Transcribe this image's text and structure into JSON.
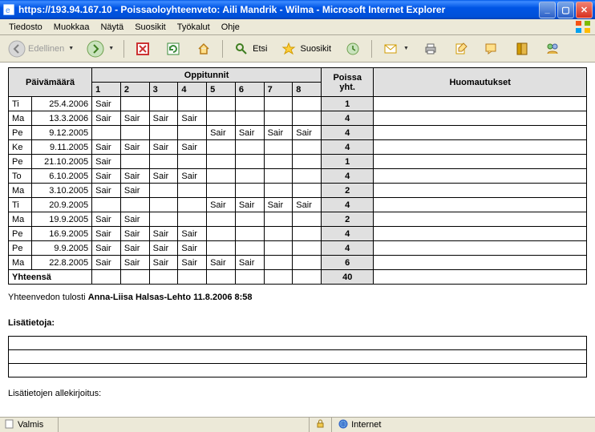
{
  "window": {
    "title": "https://193.94.167.10 - Poissaoloyhteenveto: Aili Mandrik - Wilma - Microsoft Internet Explorer"
  },
  "menu": {
    "items": [
      "Tiedosto",
      "Muokkaa",
      "Näytä",
      "Suosikit",
      "Työkalut",
      "Ohje"
    ]
  },
  "toolbar": {
    "back": "Edellinen",
    "search": "Etsi",
    "favorites": "Suosikit"
  },
  "table": {
    "head": {
      "date": "Päivämäärä",
      "lessons": "Oppitunnit",
      "cols": [
        "1",
        "2",
        "3",
        "4",
        "5",
        "6",
        "7",
        "8"
      ],
      "total": "Poissa yht.",
      "notes": "Huomautukset"
    },
    "rows": [
      {
        "day": "Ti",
        "date": "25.4.2006",
        "l": [
          "Sair",
          "",
          "",
          "",
          "",
          "",
          "",
          ""
        ],
        "total": "1"
      },
      {
        "day": "Ma",
        "date": "13.3.2006",
        "l": [
          "Sair",
          "Sair",
          "Sair",
          "Sair",
          "",
          "",
          "",
          ""
        ],
        "total": "4"
      },
      {
        "day": "Pe",
        "date": "9.12.2005",
        "l": [
          "",
          "",
          "",
          "",
          "Sair",
          "Sair",
          "Sair",
          "Sair"
        ],
        "total": "4"
      },
      {
        "day": "Ke",
        "date": "9.11.2005",
        "l": [
          "Sair",
          "Sair",
          "Sair",
          "Sair",
          "",
          "",
          "",
          ""
        ],
        "total": "4"
      },
      {
        "day": "Pe",
        "date": "21.10.2005",
        "l": [
          "Sair",
          "",
          "",
          "",
          "",
          "",
          "",
          ""
        ],
        "total": "1"
      },
      {
        "day": "To",
        "date": "6.10.2005",
        "l": [
          "Sair",
          "Sair",
          "Sair",
          "Sair",
          "",
          "",
          "",
          ""
        ],
        "total": "4"
      },
      {
        "day": "Ma",
        "date": "3.10.2005",
        "l": [
          "Sair",
          "Sair",
          "",
          "",
          "",
          "",
          "",
          ""
        ],
        "total": "2"
      },
      {
        "day": "Ti",
        "date": "20.9.2005",
        "l": [
          "",
          "",
          "",
          "",
          "Sair",
          "Sair",
          "Sair",
          "Sair"
        ],
        "total": "4"
      },
      {
        "day": "Ma",
        "date": "19.9.2005",
        "l": [
          "Sair",
          "Sair",
          "",
          "",
          "",
          "",
          "",
          ""
        ],
        "total": "2"
      },
      {
        "day": "Pe",
        "date": "16.9.2005",
        "l": [
          "Sair",
          "Sair",
          "Sair",
          "Sair",
          "",
          "",
          "",
          ""
        ],
        "total": "4"
      },
      {
        "day": "Pe",
        "date": "9.9.2005",
        "l": [
          "Sair",
          "Sair",
          "Sair",
          "Sair",
          "",
          "",
          "",
          ""
        ],
        "total": "4"
      },
      {
        "day": "Ma",
        "date": "22.8.2005",
        "l": [
          "Sair",
          "Sair",
          "Sair",
          "Sair",
          "Sair",
          "Sair",
          "",
          ""
        ],
        "total": "6"
      }
    ],
    "sum": {
      "label": "Yhteensä",
      "total": "40"
    }
  },
  "printed": {
    "prefix": "Yhteenvedon tulosti ",
    "who": "Anna-Liisa Halsas-Lehto 11.8.2006 8:58"
  },
  "extras": {
    "label": "Lisätietoja:"
  },
  "sig": {
    "label": "Lisätietojen allekirjoitus:"
  },
  "status": {
    "done": "Valmis",
    "zone": "Internet"
  }
}
